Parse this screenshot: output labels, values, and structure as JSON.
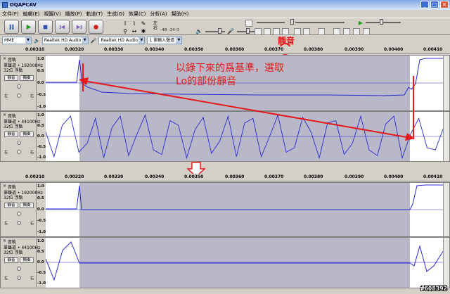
{
  "window": {
    "title": "DQAPCAV",
    "minimize": "_",
    "maximize": "□",
    "close": "×"
  },
  "menu": [
    "文件(F)",
    "編輯(E)",
    "視圖(V)",
    "播放(P)",
    "軌道(T)",
    "生成(G)",
    "效果(C)",
    "分析(A)",
    "幫助(H)"
  ],
  "toolbar": {
    "transport": [
      "pause",
      "play",
      "stop",
      "skip-start",
      "skip-end",
      "record"
    ],
    "meter_left_label": "左",
    "meter_right_label": "右",
    "meter_scale": "-48  -24   0",
    "silence_label": "靜音"
  },
  "devices": {
    "host": "MME",
    "output": "Realtek HD Audio ou",
    "input": "Realtek HD Audio Inp",
    "channels": "1 單輸入聲道"
  },
  "ruler": {
    "labels": [
      "0.00310",
      "0.00320",
      "0.00330",
      "0.00340",
      "0.00350",
      "0.00360",
      "0.00370",
      "0.00380",
      "0.00390",
      "0.00400",
      "0.00410"
    ]
  },
  "track_ctrl": {
    "name": "音軌",
    "close": "×",
    "mute": "靜音",
    "solo": "獨奏",
    "left": "左",
    "right": "右",
    "track1": {
      "info1": "單聲道 • 192000Hz",
      "info2": "32位 浮點"
    },
    "track2": {
      "info1": "單聲道 • 44100Hz",
      "info2": "32位 浮點"
    }
  },
  "scale": {
    "top": "1.0",
    "upper": "0.5",
    "mid": "0.0",
    "lower": "-0.5",
    "bottom": "-1.0"
  },
  "annotation": {
    "line1": "以錄下來的爲基準，選取",
    "line2": "Lo的部份靜音"
  },
  "watermark": "#608392",
  "colors": {
    "wave": "#2a2ad0",
    "selection": "#b8b8c8",
    "unselected": "#ffffff",
    "annotation": "#e81818"
  },
  "wave_data": {
    "track2_before": [
      0.2,
      -0.9,
      0.5,
      0.9,
      -0.7,
      -0.3,
      0.8,
      -0.95,
      0.4,
      0.9,
      -0.85,
      0.1,
      0.95,
      -0.6,
      -0.8,
      0.7,
      0.5,
      -0.95,
      0.3,
      0.85,
      -0.75,
      -0.2,
      0.9,
      -0.9,
      0.6,
      0.8,
      -0.9,
      0.0,
      0.95,
      -0.7,
      -0.5,
      0.85,
      0.2,
      -0.95,
      0.6,
      0.7,
      -0.8,
      -0.3,
      0.9,
      -0.6,
      -0.85,
      0.55,
      0.9,
      -0.95,
      0.1,
      0.8,
      -0.5,
      -0.6,
      0.4
    ],
    "track2_after_edges": [
      0.2,
      -0.9,
      0.5,
      0.9,
      -0.7
    ]
  }
}
